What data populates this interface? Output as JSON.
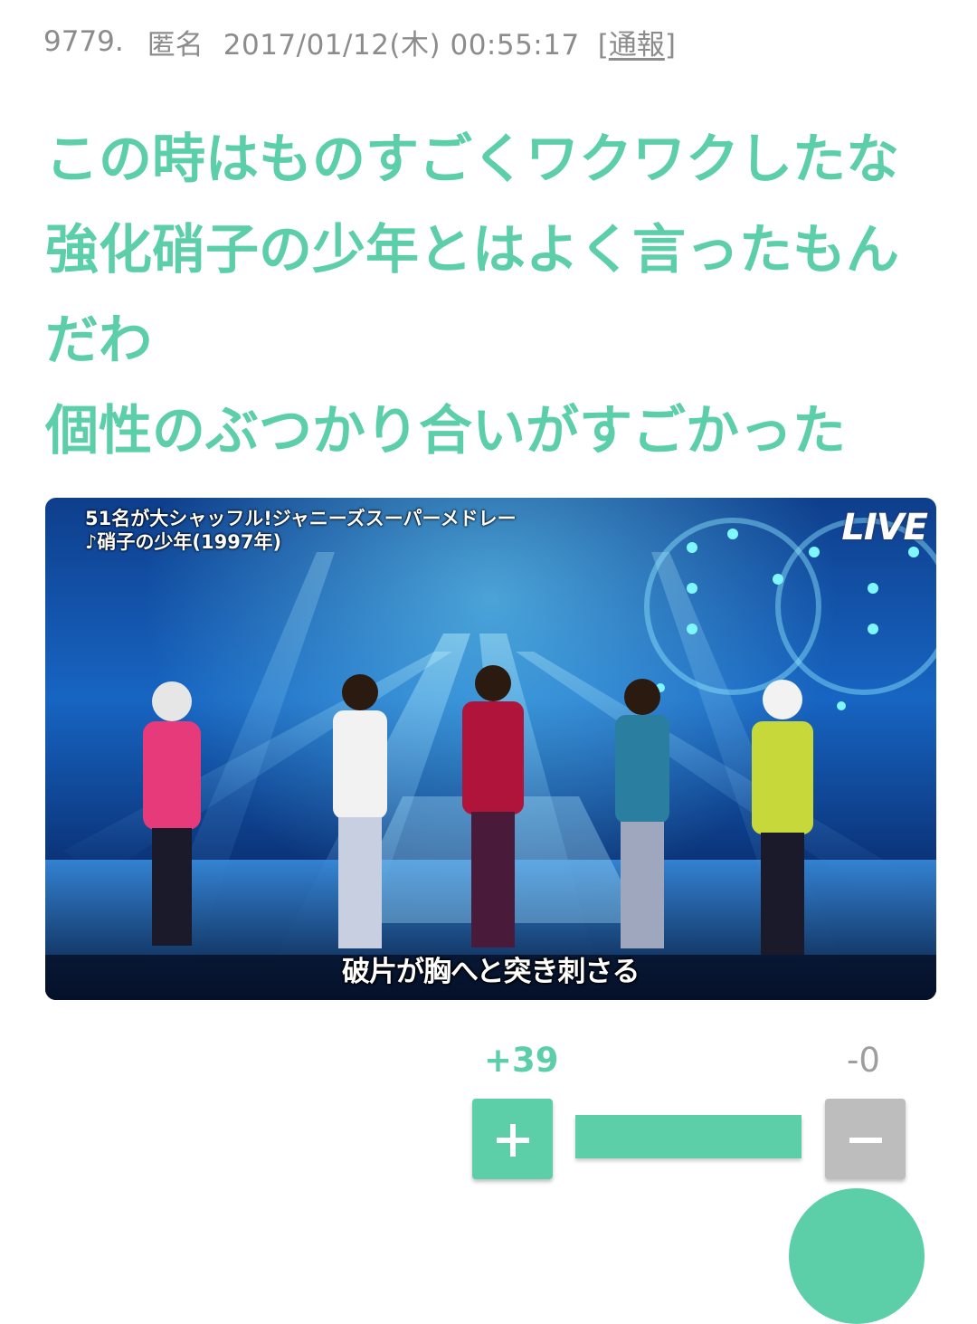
{
  "comment": {
    "number": "9779.",
    "author": "匿名",
    "datetime": "2017/01/12(木) 00:55:17",
    "report_open": "[",
    "report_label": "通報",
    "report_close": "]",
    "lines": [
      "この時はものすごくワクワクしたな",
      "強化硝子の少年とはよく言ったもん",
      "だわ",
      "個性のぶつかり合いがすごかった"
    ]
  },
  "photo": {
    "caption_line1": "51名が大シャッフル!ジャニーズスーパーメドレー",
    "caption_line2": "♪硝子の少年(1997年)",
    "live_label": "LIVE",
    "subtitle": "破片が胸へと突き刺さる"
  },
  "vote": {
    "plus_count": "+39",
    "minus_count": "-0",
    "plus_icon": "plus-icon",
    "minus_icon": "minus-icon",
    "plus_ratio": 1.0,
    "plus_color": "#5ccfa9",
    "minus_color": "#bdbdbd"
  },
  "colors": {
    "accent": "#5ccfa9",
    "meta_text": "#8c8c8c"
  }
}
